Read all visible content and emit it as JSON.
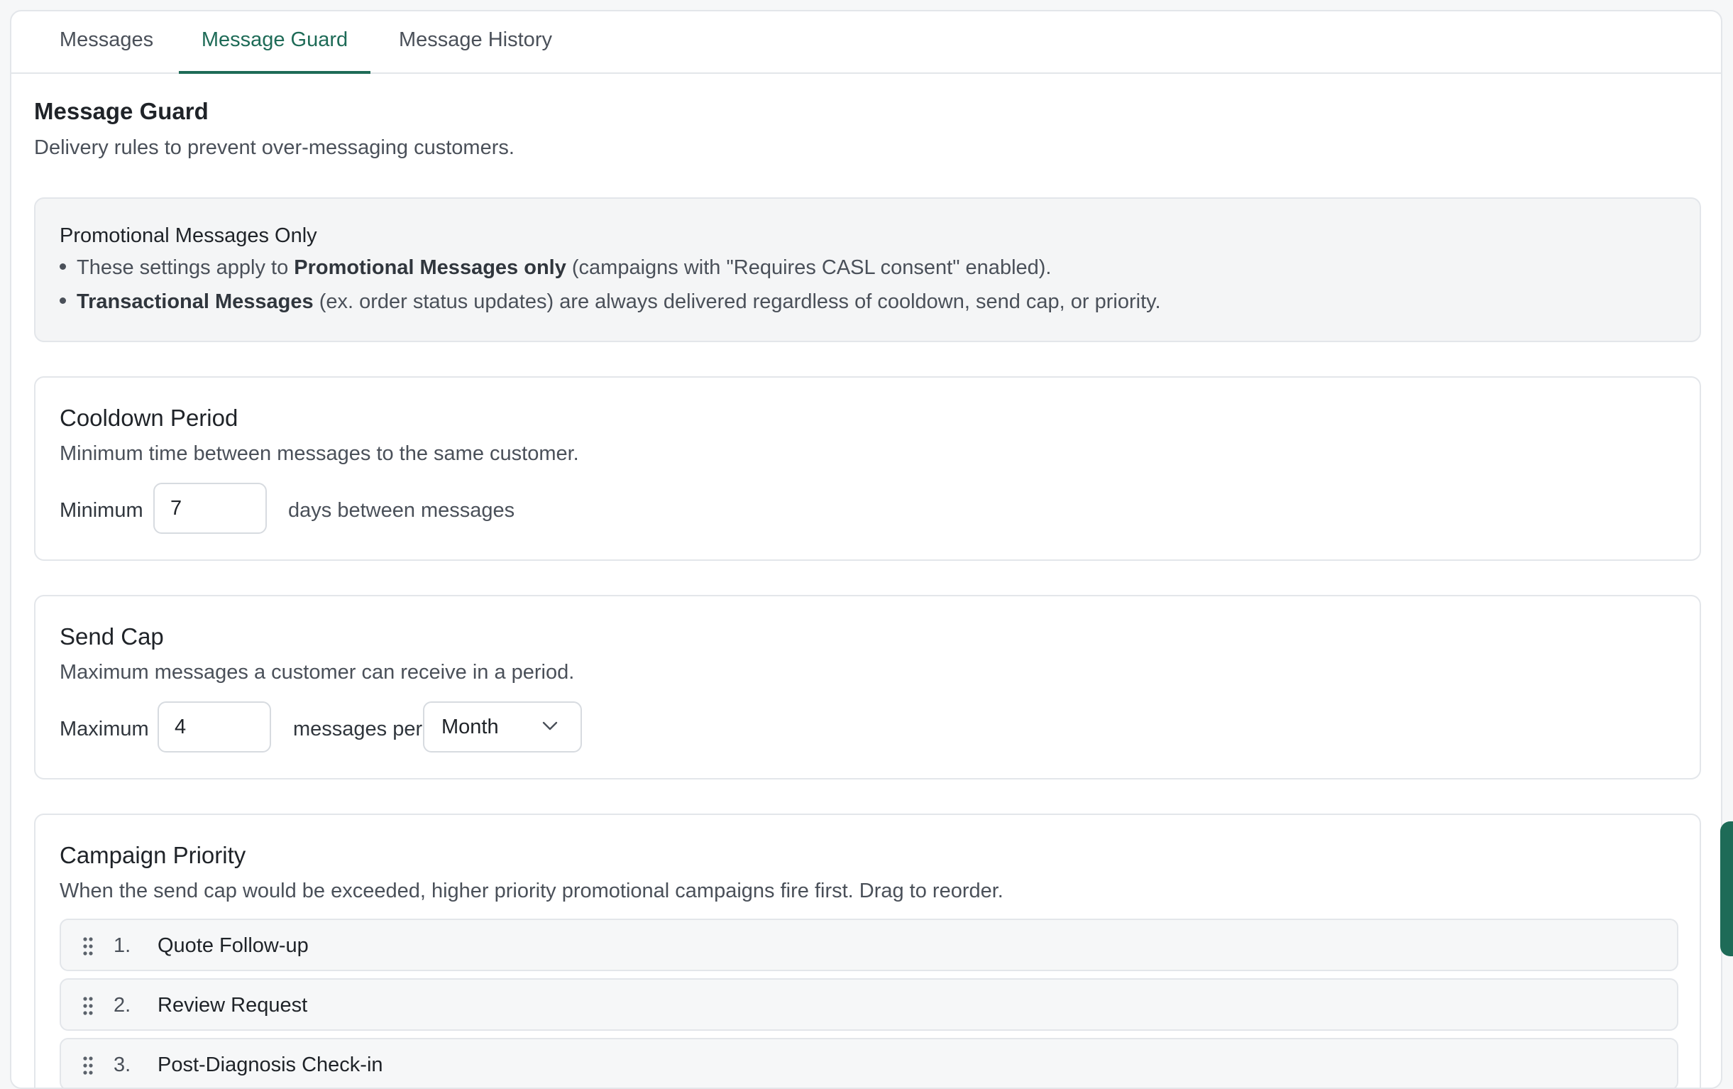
{
  "tabs": [
    {
      "label": "Messages",
      "active": false
    },
    {
      "label": "Message Guard",
      "active": true
    },
    {
      "label": "Message History",
      "active": false
    }
  ],
  "page": {
    "title": "Message Guard",
    "subtitle": "Delivery rules to prevent over-messaging customers."
  },
  "notice": {
    "title": "Promotional Messages Only",
    "bullet1": {
      "pre": "These settings apply to ",
      "bold": "Promotional Messages only",
      "post": " (campaigns with \"Requires CASL consent\" enabled)."
    },
    "bullet2": {
      "bold": "Transactional Messages",
      "post": " (ex. order status updates) are always delivered regardless of cooldown, send cap, or priority."
    }
  },
  "cooldown": {
    "title": "Cooldown Period",
    "description": "Minimum time between messages to the same customer.",
    "prefix": "Minimum",
    "value": "7",
    "suffix": "days between messages"
  },
  "send_cap": {
    "title": "Send Cap",
    "description": "Maximum messages a customer can receive in a period.",
    "prefix": "Maximum",
    "value": "4",
    "middle": "messages per",
    "period": "Month"
  },
  "priority": {
    "title": "Campaign Priority",
    "description": "When the send cap would be exceeded, higher priority promotional campaigns fire first. Drag to reorder.",
    "items": [
      {
        "num": "1.",
        "name": "Quote Follow-up"
      },
      {
        "num": "2.",
        "name": "Review Request"
      },
      {
        "num": "3.",
        "name": "Post-Diagnosis Check-in"
      }
    ]
  },
  "colors": {
    "accent": "#1e6b57",
    "text": "#1f2328",
    "muted": "#4a5059",
    "border": "#e3e6ea"
  },
  "icons": {
    "drag_handle": "drag-handle-icon",
    "select_caret": "chevron-down-icon"
  }
}
